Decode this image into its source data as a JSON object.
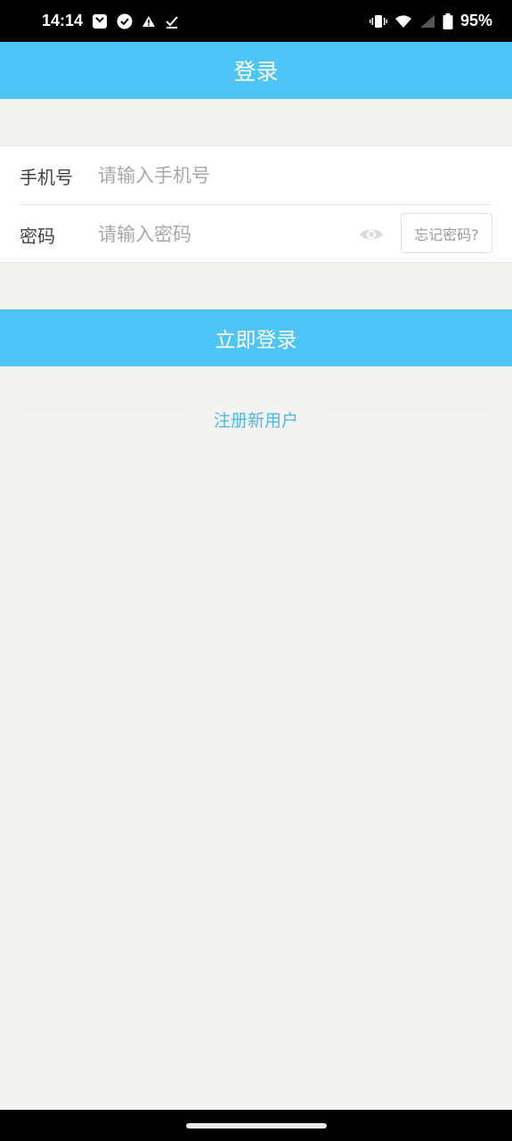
{
  "status_bar": {
    "time": "14:14",
    "battery_percent": "95%",
    "left_icons": [
      "calendar-icon",
      "check-circle-icon",
      "warning-icon",
      "download-done-icon"
    ],
    "right_icons": [
      "vibrate-icon",
      "wifi-icon",
      "signal-icon",
      "battery-icon"
    ]
  },
  "header": {
    "title": "登录"
  },
  "form": {
    "phone": {
      "label": "手机号",
      "value": "",
      "placeholder": "请输入手机号"
    },
    "password": {
      "label": "密码",
      "value": "",
      "placeholder": "请输入密码",
      "toggle_icon": "eye-icon"
    },
    "forgot_label": "忘记密码?"
  },
  "login_button": {
    "label": "立即登录"
  },
  "register": {
    "label": "注册新用户"
  },
  "colors": {
    "primary": "#4fc4f7",
    "link": "#4fb8e8",
    "background": "#f3f3f1"
  }
}
